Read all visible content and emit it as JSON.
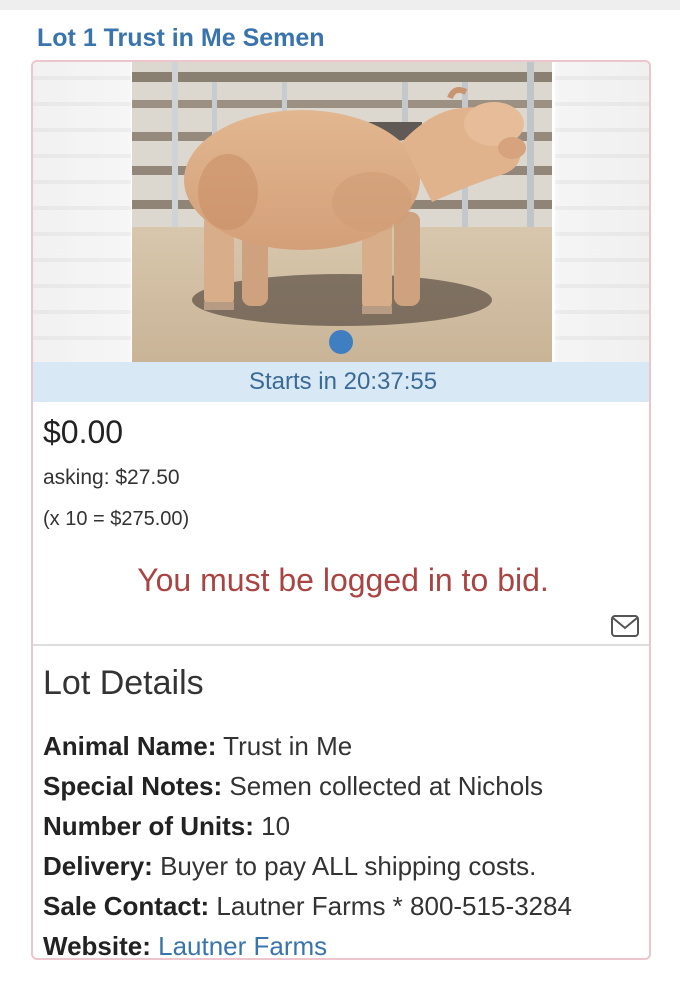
{
  "lot": {
    "title": "Lot 1 Trust in Me Semen",
    "timer": "Starts in 20:37:55",
    "current_bid": "$0.00",
    "asking": "asking: $27.50",
    "multiplier": "(x 10 = $275.00)",
    "login_message": "You must be logged in to bid."
  },
  "details": {
    "heading": "Lot Details",
    "items": [
      {
        "label": "Animal Name:",
        "value": "Trust in Me"
      },
      {
        "label": "Special Notes:",
        "value": "Semen collected at Nichols"
      },
      {
        "label": "Number of Units:",
        "value": "10"
      },
      {
        "label": "Delivery:",
        "value": "Buyer to pay ALL shipping costs."
      },
      {
        "label": "Sale Contact:",
        "value": "Lautner Farms * 800-515-3284"
      },
      {
        "label": "Website:",
        "value": "Lautner Farms"
      }
    ]
  },
  "carousel": {
    "active_index": 1,
    "count": 1
  },
  "icons": {
    "mail": "envelope-icon"
  },
  "colors": {
    "title_link": "#3a74ad",
    "timer_bar": "#d9e8f5",
    "timer_text": "#3a6a95",
    "login_message": "#a94442",
    "card_border": "#ecc6cc",
    "carousel_dot": "#3f7ec1"
  }
}
